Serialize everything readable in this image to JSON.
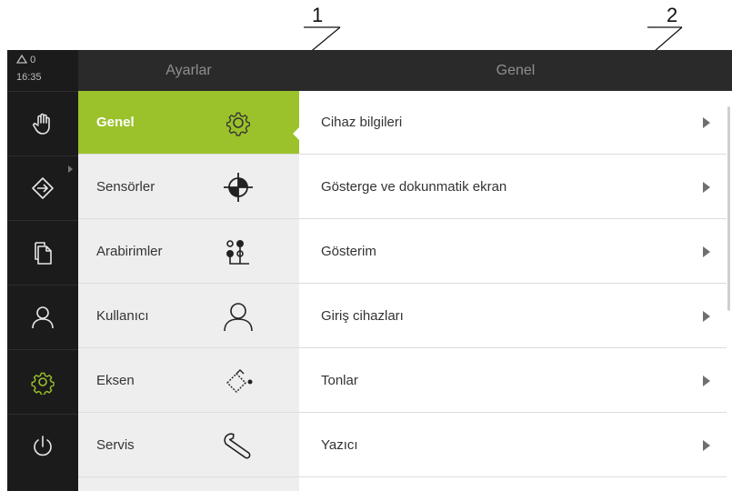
{
  "callouts": [
    {
      "number": "1"
    },
    {
      "number": "2"
    }
  ],
  "status": {
    "warning_count": "0",
    "time": "16:35"
  },
  "rail": {
    "items": [
      {
        "name": "manual-mode",
        "icon": "hand-icon"
      },
      {
        "name": "mdi-mode",
        "icon": "login-arrow-icon"
      },
      {
        "name": "documents",
        "icon": "files-icon"
      },
      {
        "name": "user",
        "icon": "user-icon"
      },
      {
        "name": "settings",
        "icon": "gear-icon",
        "active": true
      },
      {
        "name": "power",
        "icon": "power-icon"
      }
    ]
  },
  "menu": {
    "title": "Ayarlar",
    "items": [
      {
        "label": "Genel",
        "icon": "gear-icon",
        "active": true
      },
      {
        "label": "Sensörler",
        "icon": "crosshair-target-icon"
      },
      {
        "label": "Arabirimler",
        "icon": "interface-connector-icon"
      },
      {
        "label": "Kullanıcı",
        "icon": "user-icon"
      },
      {
        "label": "Eksen",
        "icon": "axis-encoder-icon"
      },
      {
        "label": "Servis",
        "icon": "wrench-icon"
      }
    ]
  },
  "panel": {
    "title": "Genel",
    "items": [
      {
        "label": "Cihaz bilgileri"
      },
      {
        "label": "Gösterge ve dokunmatik ekran"
      },
      {
        "label": "Gösterim"
      },
      {
        "label": "Giriş cihazları"
      },
      {
        "label": "Tonlar"
      },
      {
        "label": "Yazıcı"
      }
    ]
  },
  "colors": {
    "accent": "#9bc22b",
    "rail_bg": "#1b1b1b",
    "header_bg": "#2a2a2a",
    "menu_bg": "#eeeeee"
  }
}
